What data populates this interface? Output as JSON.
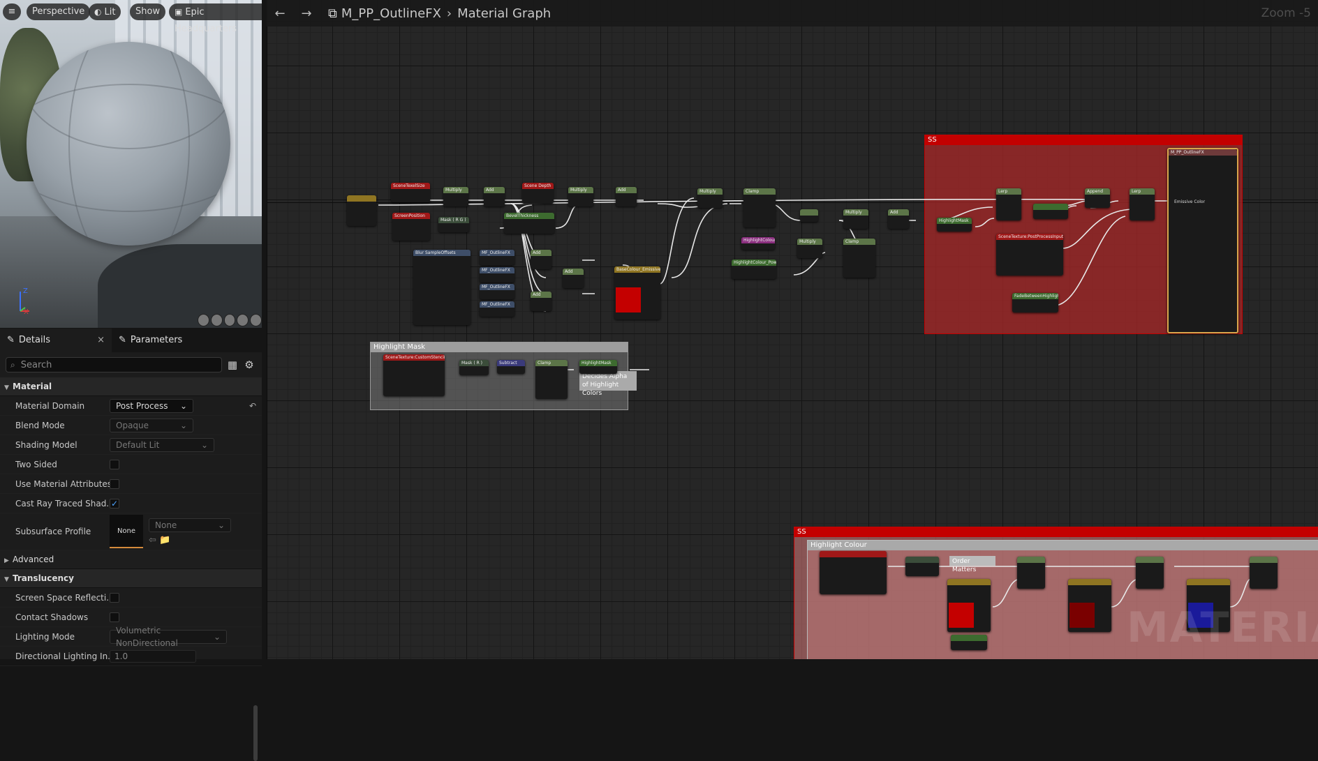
{
  "viewport": {
    "buttons": {
      "menu": "≡",
      "perspective": "Perspective",
      "lit": "Lit",
      "show": "Show",
      "level": "Epic Headquarters"
    },
    "axis": {
      "z": "Z",
      "x": "X"
    }
  },
  "details": {
    "tabs": {
      "details": "Details",
      "parameters": "Parameters",
      "close": "×"
    },
    "search_placeholder": "Search",
    "material": {
      "header": "Material",
      "material_domain": {
        "label": "Material Domain",
        "value": "Post Process"
      },
      "blend_mode": {
        "label": "Blend Mode",
        "value": "Opaque"
      },
      "shading_model": {
        "label": "Shading Model",
        "value": "Default Lit"
      },
      "two_sided": {
        "label": "Two Sided"
      },
      "use_material_attributes": {
        "label": "Use Material Attributes"
      },
      "cast_ray_traced": {
        "label": "Cast Ray Traced Shad..."
      },
      "subsurface_profile": {
        "label": "Subsurface Profile",
        "thumb": "None",
        "value": "None"
      }
    },
    "advanced": "Advanced",
    "translucency": {
      "header": "Translucency",
      "screen_space_reflection": "Screen Space Reflecti...",
      "contact_shadows": "Contact Shadows",
      "lighting_mode": {
        "label": "Lighting Mode",
        "value": "Volumetric NonDirectional"
      },
      "directional_lighting": {
        "label": "Directional Lighting In...",
        "value": "1.0"
      }
    }
  },
  "graph": {
    "breadcrumb": {
      "asset": "M_PP_OutlineFX",
      "page": "Material Graph"
    },
    "zoom": "Zoom -5",
    "comments": {
      "ss_top": "SS",
      "highlight_mask": "Highlight Mask",
      "ss_bottom": "SS",
      "highlight_colour": "Highlight Colour",
      "order_matters": "Order Matters",
      "decides_alpha": "Decides Alpha of Highlight Colors"
    },
    "watermark": "MATERIAL",
    "nodes": {
      "scene_texel": "SceneTexelSize",
      "multiply1": "Multiply",
      "add1": "Add",
      "scene_depth": "Scene Depth",
      "multiply2": "Multiply",
      "add2": "Add",
      "screen_position": "ScreenPosition",
      "mask_rg": "Mask ( R G )",
      "bevel": "BevelThickness",
      "mf_outline": "MF_OutlineFX",
      "blur_sample": "Blur SampleOffsets",
      "add3": "Add",
      "add4": "Add",
      "add5": "Add",
      "multiply3": "Multiply",
      "clamp1": "Clamp",
      "base_colour": "BaseColour_Emissive",
      "highlight_colour_node": "HighlightColour",
      "highlight_power": "HighlightColour_Power",
      "multiply4": "Multiply",
      "multiply5": "Multiply",
      "clamp2": "Clamp",
      "add6": "Add",
      "lerp1": "Lerp",
      "append": "Append",
      "lerp2": "Lerp",
      "highlight_mask_node": "HighlightMask",
      "scene_texture_pp": "SceneTexture:PostProcessInput0",
      "fade_between": "FadeBetweenHighlight",
      "output": "M_PP_OutlineFX",
      "emissive": "Emissive Color",
      "scene_texture_custom": "SceneTexture:CustomStencil",
      "mask_r": "Mask ( R )",
      "subtract": "Subtract",
      "clamp3": "Clamp",
      "hl_mask_reroute": "HighlightMask"
    }
  },
  "colors": {
    "ss_red": "#c30000",
    "accent": "#4da3ff",
    "base_swatch": "#c40000"
  }
}
